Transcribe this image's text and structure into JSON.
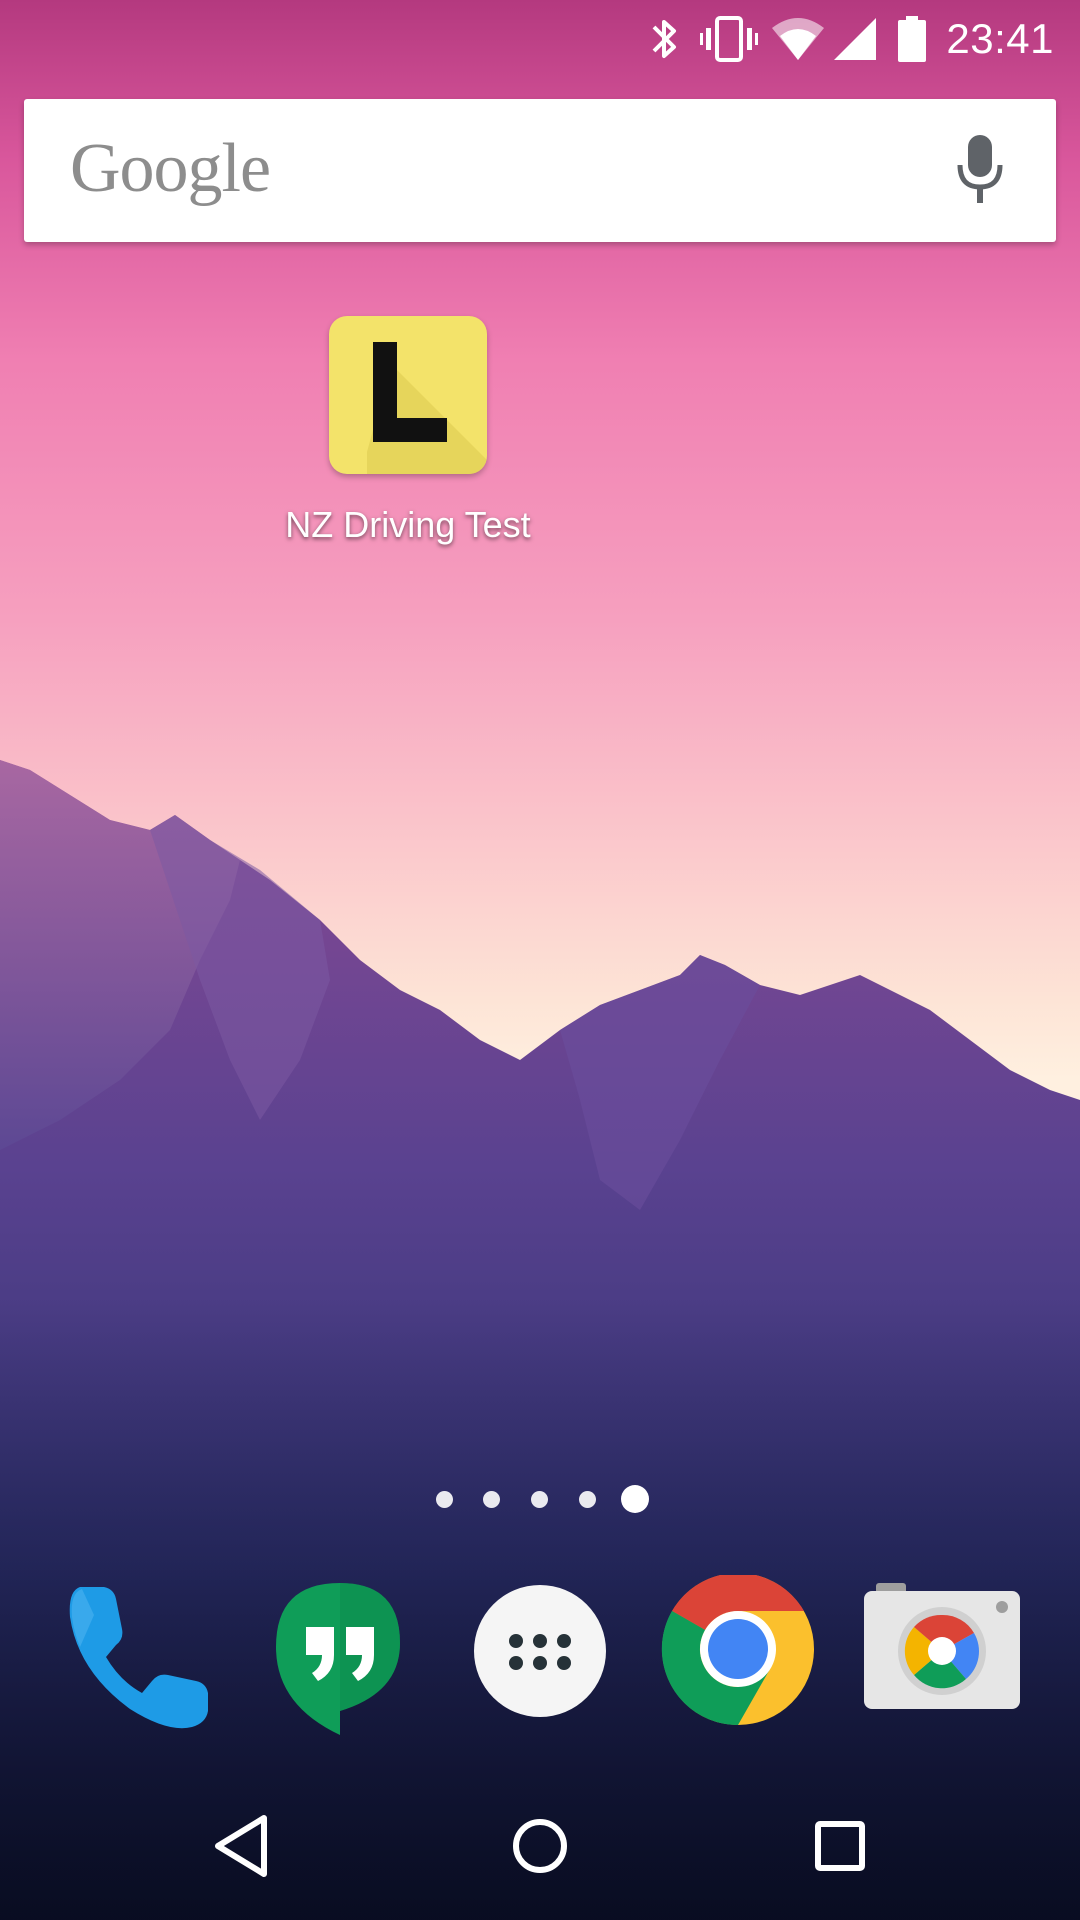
{
  "status_bar": {
    "time": "23:41",
    "icons": [
      "bluetooth-icon",
      "vibrate-icon",
      "wifi-icon",
      "cell-signal-icon",
      "battery-icon"
    ]
  },
  "search": {
    "logo_text": "Google",
    "mic_icon": "mic-icon"
  },
  "desktop": {
    "apps": [
      {
        "label": "NZ Driving Test",
        "icon": "learner-l-icon",
        "icon_color": "#f3e36a"
      }
    ]
  },
  "page_indicator": {
    "pages": 5,
    "current_page": 5
  },
  "dock": {
    "items": [
      {
        "name": "phone",
        "icon": "phone-icon"
      },
      {
        "name": "hangouts",
        "icon": "hangouts-icon"
      },
      {
        "name": "app-drawer",
        "icon": "app-drawer-icon"
      },
      {
        "name": "chrome",
        "icon": "chrome-icon"
      },
      {
        "name": "camera",
        "icon": "camera-icon"
      }
    ]
  },
  "nav_bar": {
    "buttons": [
      "back-icon",
      "home-icon",
      "recents-icon"
    ]
  },
  "colors": {
    "sky_top": "#b4397f",
    "sky_bottom": "#fff0e0",
    "mountain": "#4a3a86",
    "learner_yellow": "#f3e36a",
    "hangouts_green": "#0f9d58",
    "phone_blue": "#1e9be6"
  }
}
